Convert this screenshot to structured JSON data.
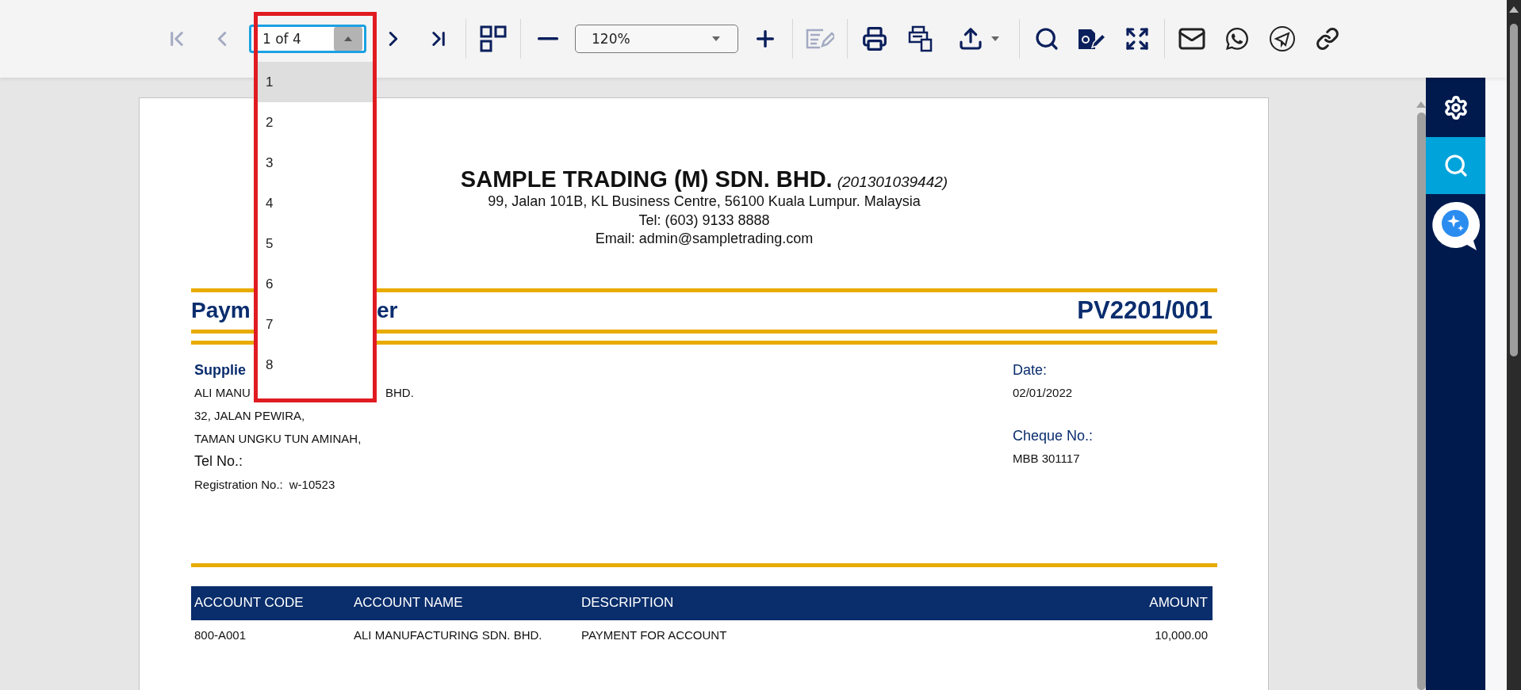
{
  "toolbar": {
    "items": [
      {
        "kind": "first",
        "disabled": true
      },
      {
        "kind": "prev",
        "disabled": true
      },
      {
        "kind": "page_field",
        "value": "1 of 4"
      },
      {
        "kind": "next",
        "disabled": false
      },
      {
        "kind": "last",
        "disabled": false
      },
      {
        "kind": "separator"
      },
      {
        "kind": "thumbnails",
        "disabled": false
      },
      {
        "kind": "separator"
      },
      {
        "kind": "zoom_out",
        "disabled": false
      },
      {
        "kind": "zoom_select",
        "value": "120%"
      },
      {
        "kind": "zoom_in",
        "disabled": false
      },
      {
        "kind": "separator"
      },
      {
        "kind": "edit",
        "disabled": true
      },
      {
        "kind": "separator"
      },
      {
        "kind": "print",
        "disabled": false
      },
      {
        "kind": "print_alt",
        "disabled": false
      },
      {
        "kind": "export",
        "disabled": false
      },
      {
        "kind": "separator"
      },
      {
        "kind": "search",
        "disabled": false
      },
      {
        "kind": "sign",
        "disabled": false
      },
      {
        "kind": "fullscreen",
        "disabled": false
      },
      {
        "kind": "separator"
      },
      {
        "kind": "email",
        "disabled": false
      },
      {
        "kind": "whatsapp",
        "disabled": false
      },
      {
        "kind": "telegram",
        "disabled": false
      },
      {
        "kind": "link",
        "disabled": false
      }
    ]
  },
  "page_menu": {
    "items": [
      {
        "label": "1",
        "selected": true
      },
      {
        "label": "2",
        "selected": false
      },
      {
        "label": "3",
        "selected": false
      },
      {
        "label": "4",
        "selected": false
      },
      {
        "label": "5",
        "selected": false
      },
      {
        "label": "6",
        "selected": false
      },
      {
        "label": "7",
        "selected": false
      },
      {
        "label": "8",
        "selected": false
      }
    ]
  },
  "sidebar": {
    "items": [
      {
        "kind": "settings",
        "selected": false
      },
      {
        "kind": "search",
        "selected": true
      },
      {
        "kind": "assistant",
        "selected": false
      }
    ]
  },
  "document": {
    "company": {
      "name": "SAMPLE TRADING (M) SDN. BHD.",
      "registration": "(201301039442)",
      "lines": [
        "99, Jalan 101B, KL Business Centre, 56100 Kuala Lumpur. Malaysia",
        "Tel: (603) 9133 8888",
        "Email: admin@sampletrading.com"
      ]
    },
    "title_parts": [
      "Paym",
      "er"
    ],
    "number": "PV2201/001",
    "supplier": {
      "label": "Supplie",
      "name_parts": [
        "ALI MANU",
        "BHD."
      ],
      "address": [
        "32, JALAN PEWIRA,",
        "TAMAN UNGKU TUN AMINAH,"
      ],
      "tel_label": "Tel No.:",
      "registration_label": "Registration No.:",
      "registration_value": "w-10523"
    },
    "details": [
      {
        "label": "Date:",
        "value": "02/01/2022"
      },
      {
        "label": "Cheque No.:",
        "value": "MBB 301117"
      }
    ],
    "table": {
      "columns": [
        "ACCOUNT CODE",
        "ACCOUNT NAME",
        "DESCRIPTION",
        "AMOUNT"
      ],
      "rows": [
        [
          "800-A001",
          "ALI MANUFACTURING SDN. BHD.",
          "PAYMENT FOR ACCOUNT",
          "10,000.00"
        ]
      ]
    }
  }
}
